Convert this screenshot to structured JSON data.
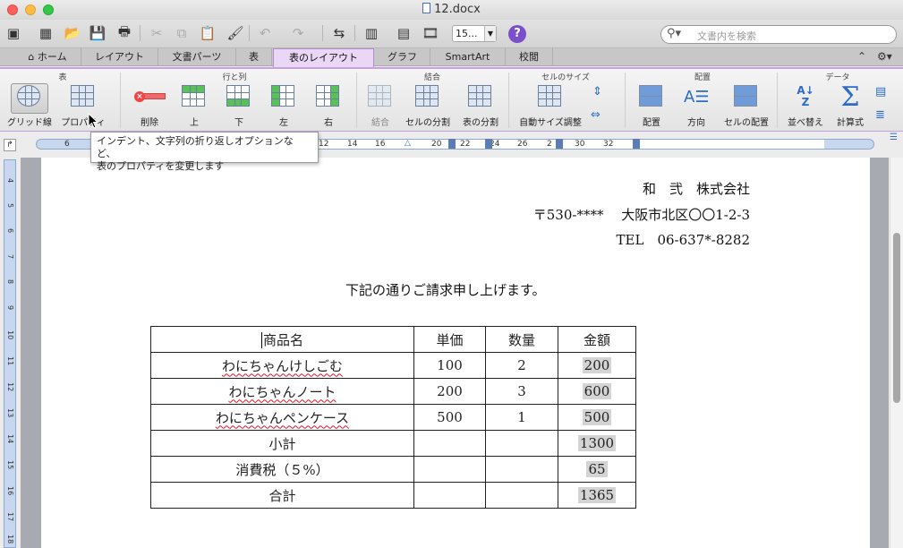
{
  "window": {
    "title": "12.docx"
  },
  "toolbar": {
    "zoom_value": "15...",
    "help_label": "?",
    "search_placeholder": "文書内を検索"
  },
  "ribbon_tabs": [
    {
      "label": "ホーム"
    },
    {
      "label": "レイアウト"
    },
    {
      "label": "文書パーツ"
    },
    {
      "label": "表"
    },
    {
      "label": "表のレイアウト"
    },
    {
      "label": "グラフ"
    },
    {
      "label": "SmartArt"
    },
    {
      "label": "校閲"
    }
  ],
  "ribbon": {
    "groups": {
      "table": "表",
      "rows_cols": "行と列",
      "merge": "結合",
      "cell_size": "セルのサイズ",
      "alignment": "配置",
      "data": "データ"
    },
    "buttons": {
      "gridlines": "グリッド線",
      "properties": "プロパティ",
      "delete": "削除",
      "above": "上",
      "below": "下",
      "left": "左",
      "right": "右",
      "merge": "結合",
      "split_cells": "セルの分割",
      "split_table": "表の分割",
      "autofit": "自動サイズ調整",
      "align": "配置",
      "direction": "方向",
      "cell_margins": "セルの配置",
      "sort": "並べ替え",
      "formula": "計算式"
    }
  },
  "tooltip": {
    "line1": "インデント、文字列の折り返しオプションなど、",
    "line2": "表のプロパティを変更します"
  },
  "ruler": {
    "numbers": [
      "6",
      "12",
      "14",
      "16",
      "20",
      "22",
      "24",
      "26",
      "2",
      "30",
      "32"
    ]
  },
  "vruler": {
    "numbers": [
      "4",
      "5",
      "6",
      "7",
      "8",
      "9",
      "10",
      "11",
      "12",
      "13",
      "14",
      "15",
      "16",
      "17",
      "18"
    ]
  },
  "document": {
    "company": "和　弐　株式会社",
    "address": "〒530-****　 大阪市北区〇〇1-2-3",
    "tel": "TEL　06-637*-8282",
    "intro": "下記の通りご請求申し上げます。",
    "table": {
      "headers": [
        "商品名",
        "単価",
        "数量",
        "金額"
      ],
      "rows": [
        [
          "わにちゃんけしごむ",
          "100",
          "2",
          "200"
        ],
        [
          "わにちゃんノート",
          "200",
          "3",
          "600"
        ],
        [
          "わにちゃんペンケース",
          "500",
          "1",
          "500"
        ]
      ],
      "subtotal_label": "小計",
      "subtotal": "1300",
      "tax_label": "消費税（５%）",
      "tax": "65",
      "total_label": "合計",
      "total": "1365"
    }
  }
}
